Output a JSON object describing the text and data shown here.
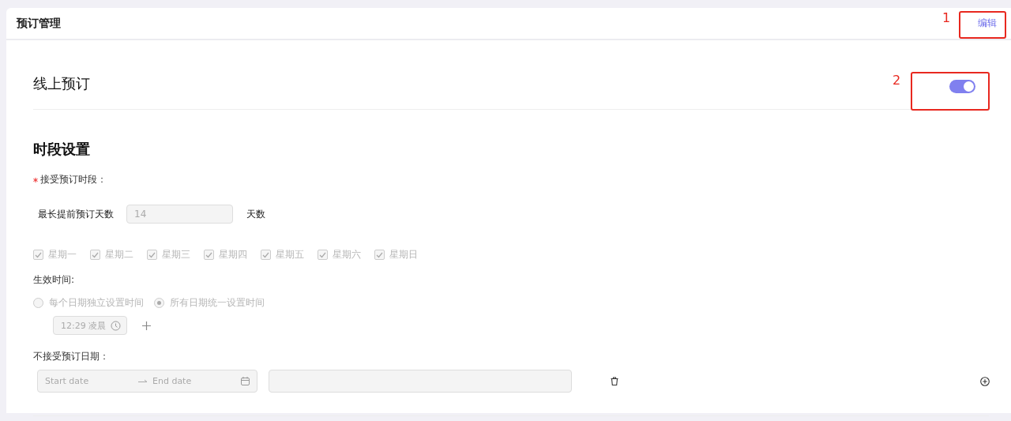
{
  "header": {
    "title": "预订管理",
    "edit_button": "编辑"
  },
  "online_booking": {
    "title": "线上预订",
    "on": true
  },
  "time_settings": {
    "title": "时段设置",
    "required": true,
    "period_label": "接受预订时段：",
    "max_days_label": "最长提前预订天数",
    "max_days_value": "14",
    "max_days_unit": "天数",
    "weekdays": [
      {
        "label": "星期一",
        "checked": true,
        "disabled": true
      },
      {
        "label": "星期二",
        "checked": true,
        "disabled": true
      },
      {
        "label": "星期三",
        "checked": true,
        "disabled": true
      },
      {
        "label": "星期四",
        "checked": true,
        "disabled": true
      },
      {
        "label": "星期五",
        "checked": true,
        "disabled": true
      },
      {
        "label": "星期六",
        "checked": true,
        "disabled": true
      },
      {
        "label": "星期日",
        "checked": true,
        "disabled": true
      }
    ],
    "effective_label": "生效时间:",
    "time_modes": [
      {
        "label": "每个日期独立设置时间",
        "selected": false,
        "disabled": true
      },
      {
        "label": "所有日期统一设置时间",
        "selected": true,
        "disabled": true
      }
    ],
    "time_value": "12:29 凌晨",
    "excluded_label": "不接受预订日期：",
    "start_placeholder": "Start date",
    "end_placeholder": "End date"
  },
  "annotations": [
    {
      "label": "1"
    },
    {
      "label": "2"
    }
  ]
}
